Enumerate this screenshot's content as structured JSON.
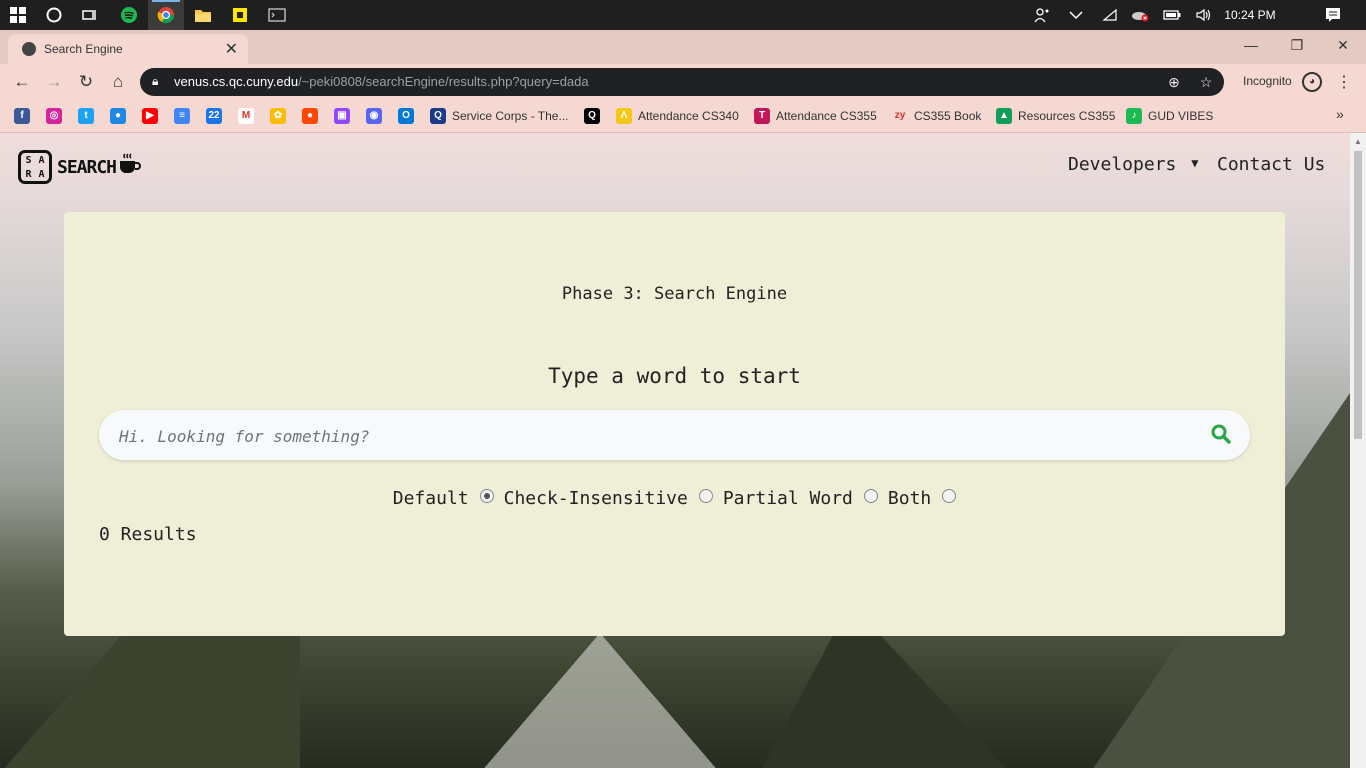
{
  "taskbar": {
    "clock": "10:24 PM",
    "apps": [
      "windows-start",
      "cortana",
      "task-view",
      "spotify",
      "chrome",
      "file-explorer",
      "sticky-notes",
      "terminal"
    ],
    "tray": [
      "people-icon",
      "chevron-up-icon",
      "wifi-icon",
      "onedrive-error-icon",
      "battery-icon",
      "volume-icon",
      "pen-icon",
      "notifications-icon"
    ]
  },
  "browser": {
    "tab_title": "Search Engine",
    "url_host": "venus.cs.qc.cuny.edu",
    "url_path": "/~peki0808/searchEngine/results.php?query=dada",
    "incognito_label": "Incognito",
    "bookmarks": [
      {
        "label": "",
        "color": "#3b5998",
        "glyph": "f"
      },
      {
        "label": "",
        "color": "#d6249f",
        "glyph": "◎"
      },
      {
        "label": "",
        "color": "#1da1f2",
        "glyph": "t"
      },
      {
        "label": "",
        "color": "#1e88e5",
        "glyph": "●"
      },
      {
        "label": "",
        "color": "#ff0000",
        "glyph": "▶"
      },
      {
        "label": "",
        "color": "#4285f4",
        "glyph": "≡"
      },
      {
        "label": "",
        "color": "#1a73e8",
        "glyph": "22"
      },
      {
        "label": "",
        "color": "#ffffff",
        "glyph": "M"
      },
      {
        "label": "",
        "color": "#fbbc04",
        "glyph": "✿"
      },
      {
        "label": "",
        "color": "#ff4500",
        "glyph": "●"
      },
      {
        "label": "",
        "color": "#9146ff",
        "glyph": "▣"
      },
      {
        "label": "",
        "color": "#5865f2",
        "glyph": "◉"
      },
      {
        "label": "",
        "color": "#0078d4",
        "glyph": "O"
      },
      {
        "label": "Service Corps - The...",
        "color": "#1a3a8a",
        "glyph": "Q"
      },
      {
        "label": "",
        "color": "#000000",
        "glyph": "Q"
      },
      {
        "label": "Attendance CS340",
        "color": "#f5c518",
        "glyph": "Λ"
      },
      {
        "label": "Attendance CS355",
        "color": "#c2185b",
        "glyph": "T"
      },
      {
        "label": "CS355 Book",
        "color": "#f5d8d2",
        "glyph": "zy"
      },
      {
        "label": "Resources CS355",
        "color": "#0f9d58",
        "glyph": "▲"
      },
      {
        "label": "GUD VIBES",
        "color": "#1db954",
        "glyph": "♪"
      }
    ]
  },
  "site": {
    "logo_letters": [
      "S",
      "A",
      "R",
      "A"
    ],
    "logo_text": "SEARCH",
    "nav": {
      "developers": "Developers",
      "contact": "Contact Us"
    }
  },
  "card": {
    "phase_title": "Phase 3: Search Engine",
    "prompt": "Type a word to start",
    "search_placeholder": "Hi. Looking for something?",
    "search_value": "",
    "options": [
      {
        "label": "Default",
        "checked": true
      },
      {
        "label": "Check-Insensitive",
        "checked": false
      },
      {
        "label": "Partial Word",
        "checked": false
      },
      {
        "label": "Both",
        "checked": false
      }
    ],
    "results_text": "0 Results"
  },
  "colors": {
    "card_bg": "#efefd8",
    "search_icon": "#28a745",
    "chrome_frame": "#f5d8d2"
  }
}
